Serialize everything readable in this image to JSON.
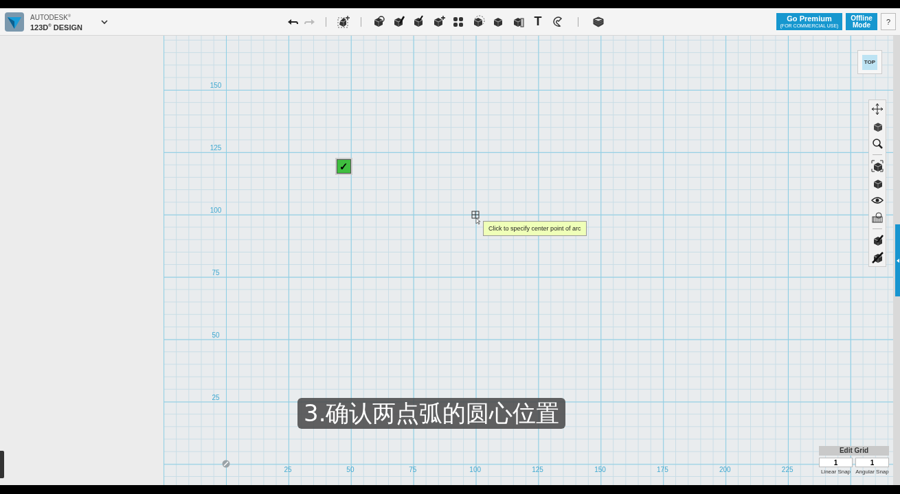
{
  "app": {
    "brand_top": "AUTODESK$^{®}$",
    "brand_bottom": "123D$^{®}$ DESIGN"
  },
  "toolbar": {
    "undo": {
      "disabled": false
    },
    "redo": {
      "disabled": true
    },
    "text_tool": "T"
  },
  "premium_button": {
    "label": "Go Premium",
    "sublabel": "(FOR COMMERCIAL USE)"
  },
  "offline_button": {
    "label": "Offline Mode"
  },
  "help_button": {
    "label": "?"
  },
  "view_cube": {
    "face": "TOP"
  },
  "canvas": {
    "y_labels": [
      "150",
      "125",
      "100",
      "75",
      "50",
      "25"
    ],
    "x_labels": [
      "25",
      "50",
      "75",
      "100",
      "125",
      "150",
      "175",
      "200",
      "225"
    ],
    "marker": {
      "glyph": "✓"
    },
    "tooltip": "Click to specify center point of arc"
  },
  "edit_grid": {
    "title": "Edit Grid",
    "fields": [
      {
        "label": "Linear Snap",
        "value": "1"
      },
      {
        "label": "Angular Snap",
        "value": "1"
      }
    ]
  },
  "caption": "3.确认两点弧的圆心位置"
}
